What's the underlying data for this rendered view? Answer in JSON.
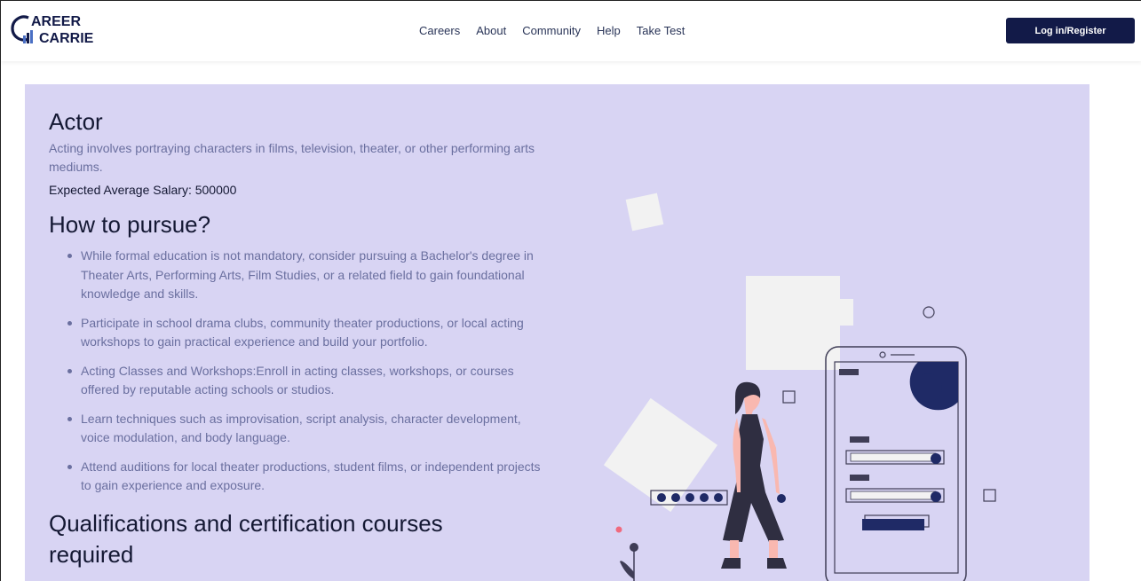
{
  "brand": {
    "logo_line1": "AREER",
    "logo_line2": "CARRIER",
    "logo_initial": "C"
  },
  "nav": {
    "links": [
      "Careers",
      "About",
      "Community",
      "Help",
      "Take Test"
    ],
    "login_label": "Log in/Register"
  },
  "career": {
    "title": "Actor",
    "description": "Acting involves portraying characters in films, television, theater, or other performing arts mediums.",
    "salary_label": "Expected Average Salary: ",
    "salary_value": "500000"
  },
  "pursue": {
    "heading": "How to pursue?",
    "steps": [
      "While formal education is not mandatory, consider pursuing a Bachelor's degree in Theater Arts, Performing Arts, Film Studies, or a related field to gain foundational knowledge and skills.",
      "Participate in school drama clubs, community theater productions, or local acting workshops to gain practical experience and build your portfolio.",
      "Acting Classes and Workshops:Enroll in acting classes, workshops, or courses offered by reputable acting schools or studios.",
      "Learn techniques such as improvisation, script analysis, character development, voice modulation, and body language.",
      "Attend auditions for local theater productions, student films, or independent projects to gain experience and exposure."
    ]
  },
  "qualifications": {
    "heading": "Qualifications and certification courses required"
  },
  "colors": {
    "brand_navy": "#121a48",
    "card_bg": "#d8d4f3",
    "muted_text": "#6a6f9f",
    "heading_text": "#141833",
    "accent_pink": "#f06a7e"
  }
}
